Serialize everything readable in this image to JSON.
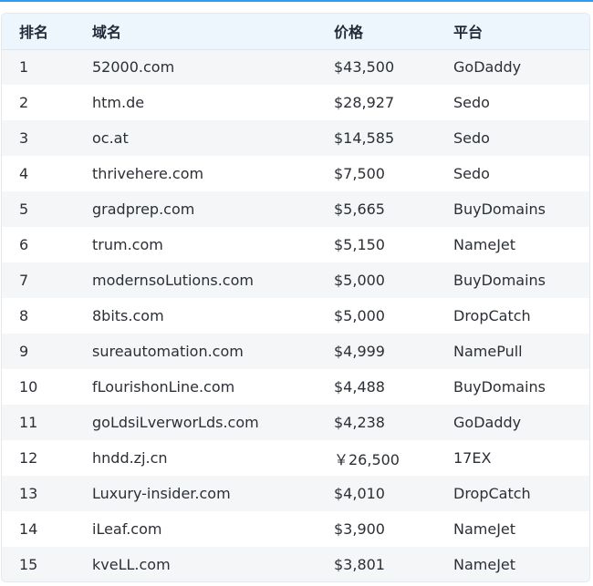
{
  "table": {
    "headers": [
      "排名",
      "域名",
      "价格",
      "平台"
    ],
    "rows": [
      [
        "1",
        "52000.com",
        "$43,500",
        "GoDaddy"
      ],
      [
        "2",
        "htm.de",
        "$28,927",
        "Sedo"
      ],
      [
        "3",
        "oc.at",
        "$14,585",
        "Sedo"
      ],
      [
        "4",
        "thrivehere.com",
        "$7,500",
        "Sedo"
      ],
      [
        "5",
        "gradprep.com",
        "$5,665",
        "BuyDomains"
      ],
      [
        "6",
        "trum.com",
        "$5,150",
        "NameJet"
      ],
      [
        "7",
        "modernsoLutions.com",
        "$5,000",
        "BuyDomains"
      ],
      [
        "8",
        "8bits.com",
        "$5,000",
        "DropCatch"
      ],
      [
        "9",
        "sureautomation.com",
        "$4,999",
        "NamePull"
      ],
      [
        "10",
        "fLourishonLine.com",
        "$4,488",
        "BuyDomains"
      ],
      [
        "11",
        "goLdsiLverworLds.com",
        "$4,238",
        "GoDaddy"
      ],
      [
        "12",
        "hndd.zj.cn",
        "￥26,500",
        "17EX"
      ],
      [
        "13",
        "Luxury-insider.com",
        "$4,010",
        "DropCatch"
      ],
      [
        "14",
        "iLeaf.com",
        "$3,900",
        "NameJet"
      ],
      [
        "15",
        "kveLL.com",
        "$3,801",
        "NameJet"
      ]
    ]
  }
}
